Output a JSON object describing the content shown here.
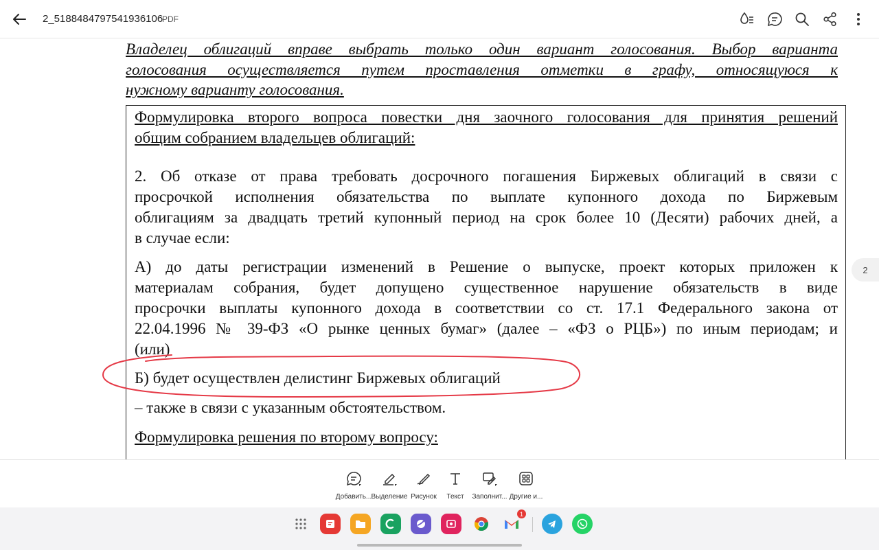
{
  "topbar": {
    "title": "2_5188484797541936106",
    "file_type": "PDF",
    "icons": [
      "back-arrow-icon",
      "read-mode-icon",
      "comments-icon",
      "search-icon",
      "share-icon",
      "more-vert-icon"
    ]
  },
  "document": {
    "intro_lines": [
      "Владелец облигаций вправе выбрать только один вариант голосования. Выбор варианта",
      "голосования осуществляется путем проставления отметки в графу, относящуюся к",
      "нужному варианту голосования."
    ],
    "question_heading_lines": [
      "Формулировка второго вопроса повестки дня заочного голосования для принятия решений",
      "общим собранием владельцев облигаций:"
    ],
    "paragraph_1_lines": [
      "2. Об отказе от права требовать досрочного погашения Биржевых облигаций в связи с",
      "просрочкой исполнения обязательства по выплате купонного дохода по Биржевым",
      "облигациям за двадцать третий купонный период на срок более 10 (Десяти) рабочих дней, а",
      "в случае если:"
    ],
    "paragraph_a_lines": [
      "А) до даты регистрации изменений в Решение о выпуске, проект которых приложен к",
      "материалам собрания, будет допущено существенное нарушение обязательств в виде",
      "просрочки выплаты купонного дохода в соответствии со ст. 17.1 Федерального закона от",
      "22.04.1996 № 39-ФЗ «О рынке ценных бумаг» (далее – «ФЗ о РЦБ») по иным периодам; и",
      "(или)"
    ],
    "paragraph_b": "Б) будет осуществлен делистинг Биржевых облигаций",
    "paragraph_also": "–  также в связи с указанным обстоятельством.",
    "decision_heading": "Формулировка решения по второму вопросу:",
    "page_number": "2",
    "annotation_color": "#e53946"
  },
  "toolbar": {
    "tools": [
      {
        "label": "Добавить...",
        "icon": "add-comment-icon"
      },
      {
        "label": "Выделение",
        "icon": "highlighter-icon"
      },
      {
        "label": "Рисунок",
        "icon": "pen-draw-icon"
      },
      {
        "label": "Текст",
        "icon": "text-icon"
      },
      {
        "label": "Заполнит...",
        "icon": "fill-sign-icon"
      },
      {
        "label": "Другие и...",
        "icon": "more-tools-icon"
      }
    ]
  },
  "taskbar": {
    "apps": [
      {
        "name": "apps-grid-icon"
      },
      {
        "name": "notes-app-icon",
        "color": "#e53935"
      },
      {
        "name": "files-app-icon",
        "color": "#f5a623"
      },
      {
        "name": "phone-app-icon",
        "color": "#1aa260"
      },
      {
        "name": "internet-app-icon",
        "color": "#6a5acd"
      },
      {
        "name": "gallery-app-icon",
        "color": "#e0245e"
      },
      {
        "name": "chrome-app-icon"
      },
      {
        "name": "gmail-app-icon",
        "badge": "1"
      },
      {
        "name": "telegram-app-icon",
        "color": "#2aa3de"
      },
      {
        "name": "whatsapp-app-icon",
        "color": "#25d366"
      }
    ]
  }
}
